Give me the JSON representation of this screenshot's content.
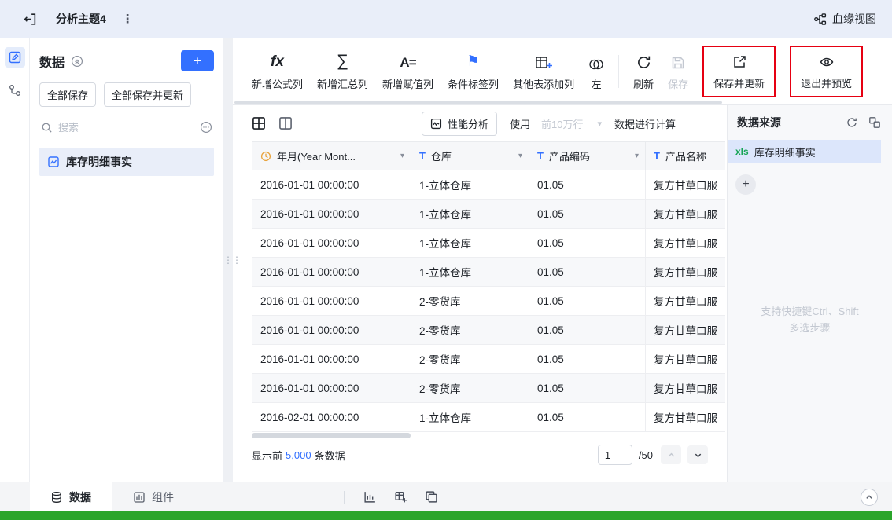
{
  "colors": {
    "accent": "#3370ff",
    "annotation_red": "#e60012",
    "xls_green": "#15a454",
    "bottom_strip_green": "#2ba52b"
  },
  "icons": {
    "formula": "fx",
    "sigma": "∑",
    "assign": "A=",
    "flag": "⚑",
    "more": "⋮",
    "text_type": "T",
    "caret": "▾",
    "drag": "⋮⋮",
    "plus": "+"
  },
  "header": {
    "title": "分析主题4",
    "lineage_label": "血缘视图"
  },
  "sidebar": {
    "title": "数据",
    "add_label": "+",
    "save_all_label": "全部保存",
    "save_all_update_label": "全部保存并更新",
    "search_placeholder": "搜索",
    "items": [
      {
        "label": "库存明细事实"
      }
    ]
  },
  "toolbar": {
    "add_formula": "新增公式列",
    "add_summary": "新增汇总列",
    "add_assign": "新增赋值列",
    "cond_tag": "条件标签列",
    "other_table": "其他表添加列",
    "merge_left": "左",
    "refresh": "刷新",
    "save": "保存",
    "save_update": "保存并更新",
    "exit_preview": "退出并预览"
  },
  "controls": {
    "performance": "性能分析",
    "use": "使用",
    "limit": "前10万行",
    "calc": "数据进行计算"
  },
  "table": {
    "columns": [
      {
        "name": "年月(Year Mont...",
        "type": "date"
      },
      {
        "name": "仓库",
        "type": "text"
      },
      {
        "name": "产品编码",
        "type": "text"
      },
      {
        "name": "产品名称",
        "type": "text"
      }
    ],
    "rows": [
      [
        "2016-01-01 00:00:00",
        "1-立体仓库",
        "01.05",
        "复方甘草口服"
      ],
      [
        "2016-01-01 00:00:00",
        "1-立体仓库",
        "01.05",
        "复方甘草口服"
      ],
      [
        "2016-01-01 00:00:00",
        "1-立体仓库",
        "01.05",
        "复方甘草口服"
      ],
      [
        "2016-01-01 00:00:00",
        "1-立体仓库",
        "01.05",
        "复方甘草口服"
      ],
      [
        "2016-01-01 00:00:00",
        "2-零货库",
        "01.05",
        "复方甘草口服"
      ],
      [
        "2016-01-01 00:00:00",
        "2-零货库",
        "01.05",
        "复方甘草口服"
      ],
      [
        "2016-01-01 00:00:00",
        "2-零货库",
        "01.05",
        "复方甘草口服"
      ],
      [
        "2016-01-01 00:00:00",
        "2-零货库",
        "01.05",
        "复方甘草口服"
      ],
      [
        "2016-02-01 00:00:00",
        "1-立体仓库",
        "01.05",
        "复方甘草口服"
      ]
    ]
  },
  "footer": {
    "show_prefix": "显示前",
    "count": "5,000",
    "show_suffix": "条数据",
    "page_value": "1",
    "page_total": "/50"
  },
  "source_panel": {
    "title": "数据来源",
    "item_badge": "xls",
    "item_label": "库存明细事实",
    "add_label": "+",
    "hint1": "支持快捷键Ctrl、Shift",
    "hint2": "多选步骤"
  },
  "bottom": {
    "tab_data": "数据",
    "tab_component": "组件"
  }
}
